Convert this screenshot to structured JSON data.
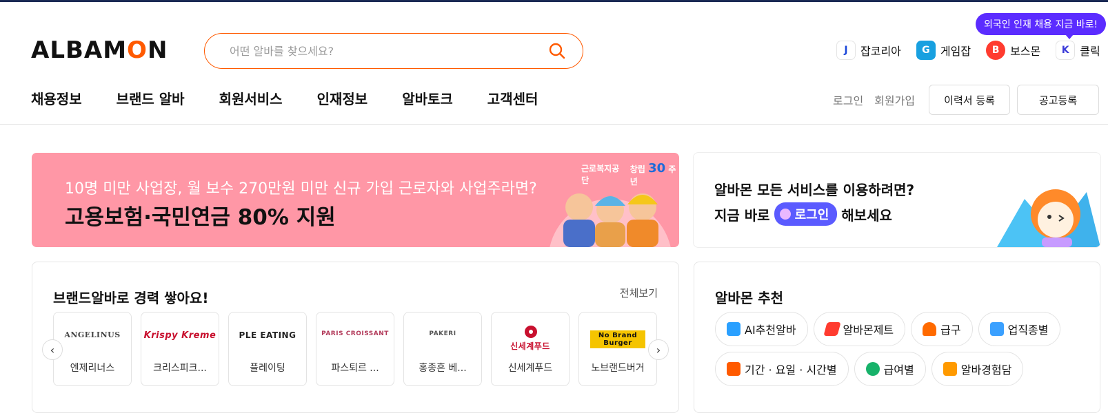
{
  "header": {
    "logo_pre": "ALBAM",
    "logo_o": "O",
    "logo_post": "N",
    "search_placeholder": "어떤 알바를 찾으세요?",
    "promo_bubble": "외국인 인재 채용 지금 바로!",
    "partners": [
      {
        "badge": "J",
        "label": "잡코리아",
        "color": "#1a46d9"
      },
      {
        "badge": "G",
        "label": "게임잡",
        "color": "#18a0e0"
      },
      {
        "badge": "B",
        "label": "보스몬",
        "color": "#ff3b2f"
      },
      {
        "badge": "K",
        "label": "클릭",
        "color": "#3b3bd9"
      }
    ],
    "nav": [
      "채용정보",
      "브랜드 알바",
      "회원서비스",
      "인재정보",
      "알바토크",
      "고객센터"
    ],
    "login": "로그인",
    "signup": "회원가입",
    "resume_button": "이력서 등록",
    "post_button": "공고등록"
  },
  "banner": {
    "line1": "10명 미만 사업장, 월 보수 270만원 미만 신규 가입 근로자와 사업주라면?",
    "line2": "고용보험·국민연금 80% 지원",
    "agency": "근로복지공단",
    "anniv_pre": "창립",
    "anniv_num": "30",
    "anniv_post": "주년"
  },
  "login_card": {
    "line1": "알바몬 모든 서비스를 이용하려면?",
    "line2_pre": "지금 바로",
    "pill": "로그인",
    "line2_post": "해보세요"
  },
  "brand_section": {
    "title": "브랜드알바로 경력 쌓아요!",
    "more": "전체보기",
    "brands": [
      {
        "logo": "ANGELINUS",
        "name": "엔제리너스"
      },
      {
        "logo": "Krispy Kreme",
        "name": "크리스피크..."
      },
      {
        "logo": "PLE EATING",
        "name": "플레이팅"
      },
      {
        "logo": "PARIS CROISSANT",
        "name": "파스퇴르 ..."
      },
      {
        "logo": "PAKERI",
        "name": "홍종흔 베..."
      },
      {
        "logo": "신세계푸드",
        "name": "신세계푸드"
      },
      {
        "logo": "No Brand Burger",
        "name": "노브랜드버거"
      }
    ]
  },
  "recommend": {
    "title": "알바몬 추천",
    "chips": [
      {
        "label": "AI추천알바",
        "icon": "ai-icon",
        "color": "#2aa0ff"
      },
      {
        "label": "알바몬제트",
        "icon": "jet-icon",
        "color": "#ff3b2f"
      },
      {
        "label": "급구",
        "icon": "siren-icon",
        "color": "#ff6a00"
      },
      {
        "label": "업직종별",
        "icon": "bag-icon",
        "color": "#3aa0ff"
      },
      {
        "label": "기간 · 요일 · 시간별",
        "icon": "calendar-icon",
        "color": "#ff5a00"
      },
      {
        "label": "급여별",
        "icon": "won-icon",
        "color": "#17b26a"
      },
      {
        "label": "알바경험담",
        "icon": "chat-icon",
        "color": "#ff9a00"
      }
    ]
  }
}
